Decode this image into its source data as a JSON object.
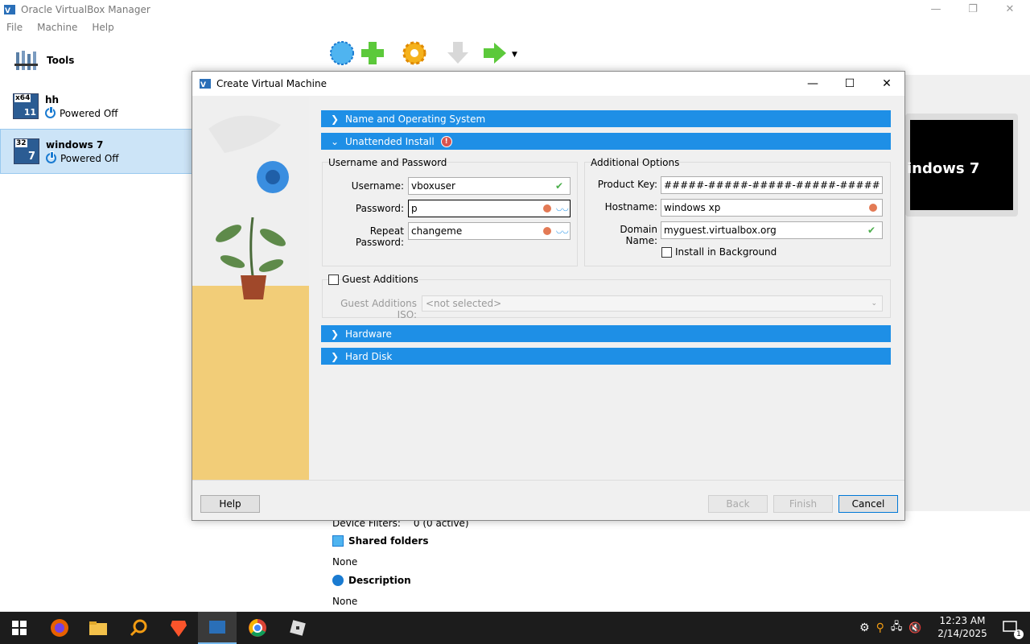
{
  "main_window": {
    "title": "Oracle VirtualBox Manager",
    "menu": [
      "File",
      "Machine",
      "Help"
    ]
  },
  "sidebar": {
    "tools_label": "Tools",
    "vms": [
      {
        "name": "hh",
        "state": "Powered Off",
        "badge_top": "x64",
        "badge_num": "11"
      },
      {
        "name": "windows 7",
        "state": "Powered Off",
        "badge_top": "32",
        "badge_num": "7"
      }
    ]
  },
  "preview": {
    "label": "indows 7"
  },
  "details": {
    "device_filters_label": "Device Filters:",
    "device_filters_value": "0 (0 active)",
    "shared_folders_header": "Shared folders",
    "shared_folders_value": "None",
    "description_header": "Description",
    "description_value": "None"
  },
  "dialog": {
    "title": "Create Virtual Machine",
    "sections": {
      "name_os": "Name and Operating System",
      "unattended": "Unattended Install",
      "hardware": "Hardware",
      "hard_disk": "Hard Disk"
    },
    "user_group": {
      "title": "Username and Password",
      "username_label": "Username:",
      "username_value": "vboxuser",
      "password_label": "Password:",
      "password_value": "p",
      "repeat_label": "Repeat Password:",
      "repeat_value": "changeme"
    },
    "options_group": {
      "title": "Additional Options",
      "product_key_label": "Product Key:",
      "product_key_value": "#####-#####-#####-#####-#####",
      "hostname_label": "Hostname:",
      "hostname_value": "windows xp",
      "domain_label": "Domain Name:",
      "domain_value": "myguest.virtualbox.org",
      "install_bg_label": "Install in Background"
    },
    "guest_additions": {
      "label": "Guest Additions",
      "iso_label": "Guest Additions ISO:",
      "iso_value": "<not selected>"
    },
    "buttons": {
      "help": "Help",
      "back": "Back",
      "finish": "Finish",
      "cancel": "Cancel"
    }
  },
  "taskbar": {
    "time": "12:23 AM",
    "date": "2/14/2025",
    "notification_count": "1"
  },
  "colors": {
    "section_blue": "#1e8fe6",
    "selected_vm": "#cce4f7"
  }
}
